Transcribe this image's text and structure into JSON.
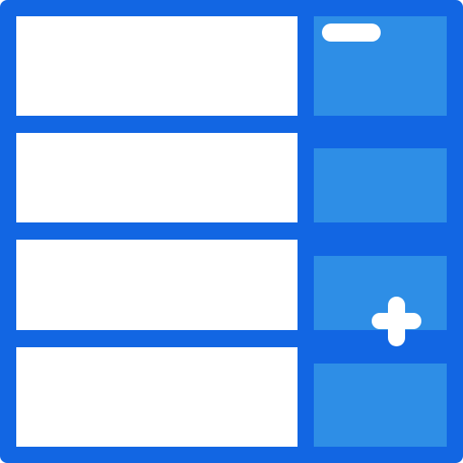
{
  "icon": {
    "name": "spreadsheet-add-remove-icon",
    "rows": 4,
    "colors": {
      "frame": "#1266E3",
      "cell": "#FFFFFF",
      "side_cell": "#2E8EE6",
      "glyph": "#FFFFFF"
    },
    "glyphs": [
      "minus",
      "plus"
    ]
  }
}
